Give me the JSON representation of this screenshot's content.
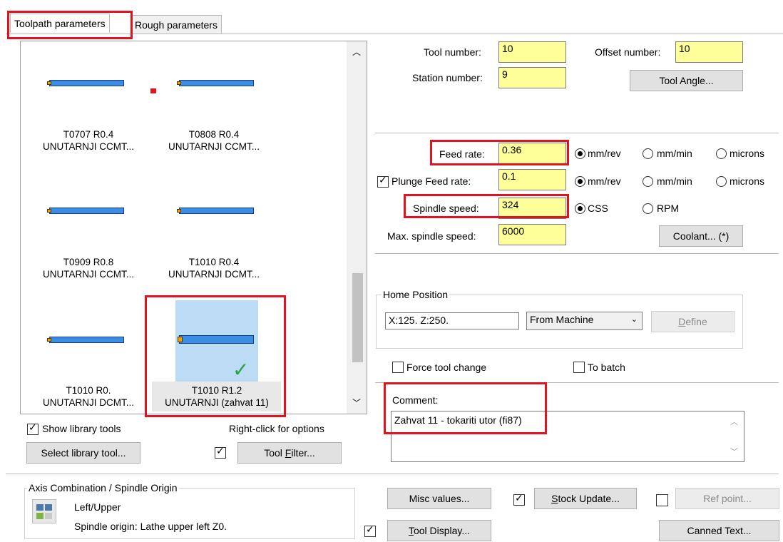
{
  "tabs": [
    {
      "label": "Toolpath parameters"
    },
    {
      "label": "Rough parameters"
    }
  ],
  "tools": [
    {
      "line1": "T0707 R0.4",
      "line2": "UNUTARNJI CCMT..."
    },
    {
      "line1": "T0808 R0.4",
      "line2": "UNUTARNJI CCMT..."
    },
    {
      "line1": "T0909 R0.8",
      "line2": "UNUTARNJI CCMT..."
    },
    {
      "line1": "T1010 R0.4",
      "line2": "UNUTARNJI DCMT..."
    },
    {
      "line1": "T1010 R0.",
      "line2": "UNUTARNJI DCMT..."
    },
    {
      "line1": "T1010 R1.2",
      "line2": "UNUTARNJI (zahvat 11)"
    }
  ],
  "library": {
    "show_library_tools": "Show library tools",
    "right_click_hint": "Right-click for options",
    "select_library_tool": "Select library tool...",
    "tool_filter_prefix": "Tool ",
    "tool_filter_underline": "F",
    "tool_filter_suffix": "ilter..."
  },
  "tool_params": {
    "tool_number_label": "Tool number:",
    "tool_number": "10",
    "offset_number_label": "Offset number:",
    "offset_number": "10",
    "station_number_label": "Station number:",
    "station_number": "9",
    "tool_angle_button": "Tool Angle..."
  },
  "feeds": {
    "feed_rate_label": "Feed rate:",
    "feed_rate": "0.36",
    "plunge_feed_label": "Plunge Feed rate:",
    "plunge_feed": "0.1",
    "spindle_speed_label": "Spindle speed:",
    "spindle_speed": "324",
    "max_spindle_label": "Max. spindle speed:",
    "max_spindle": "6000",
    "mm_rev": "mm/rev",
    "mm_min": "mm/min",
    "microns": "microns",
    "css": "CSS",
    "rpm": "RPM",
    "coolant_button": "Coolant... (*)"
  },
  "home": {
    "title": "Home Position",
    "coords": "X:125.  Z:250.",
    "from_machine": "From Machine",
    "define_prefix": "",
    "define_underline": "D",
    "define_suffix": "efine"
  },
  "options": {
    "force_tool_change": "Force tool change",
    "to_batch": "To batch"
  },
  "comment": {
    "label": "Comment:",
    "text": "Zahvat 11 - tokariti utor (fi87)"
  },
  "axis": {
    "title": "Axis Combination / Spindle Origin",
    "name": "Left/Upper",
    "origin": "Spindle origin: Lathe upper left  Z0."
  },
  "bottom_buttons": {
    "misc_values": "Misc values...",
    "stock_update_underline": "S",
    "stock_update_suffix": "tock Update...",
    "ref_point": "Ref point...",
    "tool_display_underline": "T",
    "tool_display_suffix": "ool Display...",
    "canned_text": "Canned Text..."
  },
  "colors": {
    "highlight_red": "#e0141e",
    "field_yellow": "#ffff99",
    "tool_blue": "#3b8ee6",
    "selected_bg": "#bcdcf5",
    "check_green": "#2ea043"
  }
}
